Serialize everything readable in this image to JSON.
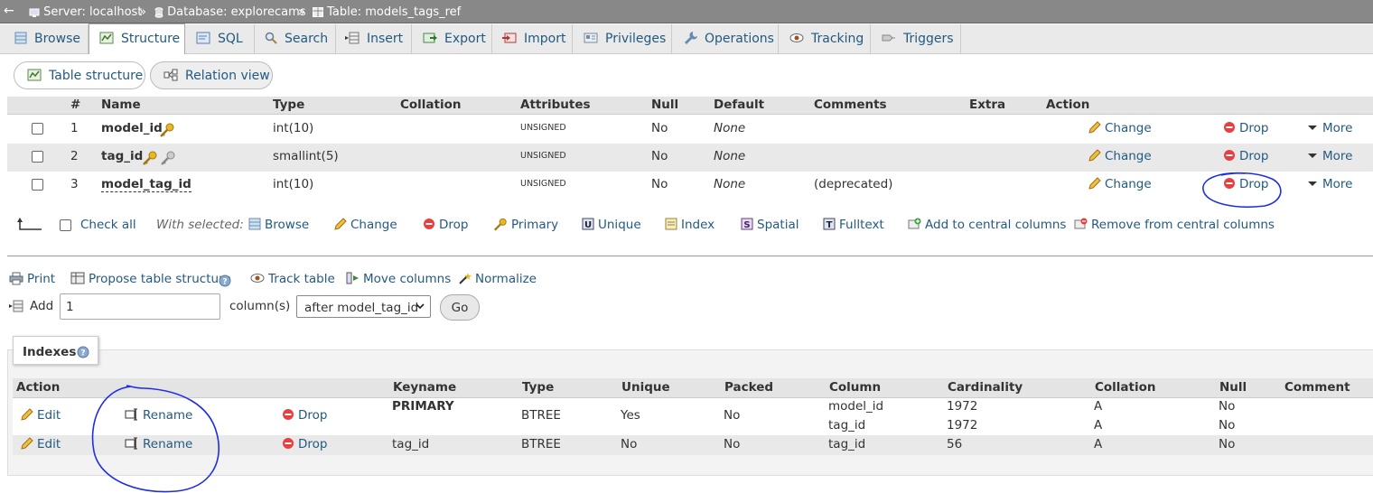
{
  "breadcrumb": {
    "back": "←",
    "server": "Server: localhost",
    "database": "Database: explorecams",
    "table": "Table: models_tags_ref",
    "sep": "»"
  },
  "tabs": [
    {
      "label": "Browse",
      "icon": "browse-icon"
    },
    {
      "label": "Structure",
      "icon": "structure-icon"
    },
    {
      "label": "SQL",
      "icon": "sql-icon"
    },
    {
      "label": "Search",
      "icon": "search-icon"
    },
    {
      "label": "Insert",
      "icon": "insert-icon"
    },
    {
      "label": "Export",
      "icon": "export-icon"
    },
    {
      "label": "Import",
      "icon": "import-icon"
    },
    {
      "label": "Privileges",
      "icon": "privileges-icon"
    },
    {
      "label": "Operations",
      "icon": "wrench-icon"
    },
    {
      "label": "Tracking",
      "icon": "eye-icon"
    },
    {
      "label": "Triggers",
      "icon": "triggers-icon"
    }
  ],
  "subtabs": {
    "table_structure": "Table structure",
    "relation_view": "Relation view"
  },
  "structure": {
    "headers": {
      "num": "#",
      "name": "Name",
      "type": "Type",
      "collation": "Collation",
      "attributes": "Attributes",
      "null": "Null",
      "default": "Default",
      "comments": "Comments",
      "extra": "Extra",
      "action": "Action"
    },
    "rows": [
      {
        "num": "1",
        "name": "model_id",
        "type": "int(10)",
        "attributes": "UNSIGNED",
        "null": "No",
        "default": "None",
        "comments": ""
      },
      {
        "num": "2",
        "name": "tag_id",
        "type": "smallint(5)",
        "attributes": "UNSIGNED",
        "null": "No",
        "default": "None",
        "comments": ""
      },
      {
        "num": "3",
        "name": "model_tag_id",
        "type": "int(10)",
        "attributes": "UNSIGNED",
        "null": "No",
        "default": "None",
        "comments": "(deprecated)"
      }
    ],
    "actions": {
      "change": "Change",
      "drop": "Drop",
      "more": "More"
    }
  },
  "bulk": {
    "check_all": "Check all",
    "with_selected": "With selected:",
    "browse": "Browse",
    "change": "Change",
    "drop": "Drop",
    "primary": "Primary",
    "unique": "Unique",
    "index": "Index",
    "spatial": "Spatial",
    "fulltext": "Fulltext",
    "add_central": "Add to central columns",
    "remove_central": "Remove from central columns"
  },
  "tools": {
    "print": "Print",
    "propose": "Propose table structure",
    "track": "Track table",
    "move": "Move columns",
    "normalize": "Normalize"
  },
  "add_column": {
    "label": "Add",
    "value": "1",
    "suffix": "column(s)",
    "position": "after model_tag_id",
    "go": "Go"
  },
  "indexes": {
    "title": "Indexes",
    "headers": {
      "action": "Action",
      "keyname": "Keyname",
      "type": "Type",
      "unique": "Unique",
      "packed": "Packed",
      "column": "Column",
      "cardinality": "Cardinality",
      "collation": "Collation",
      "null": "Null",
      "comment": "Comment"
    },
    "actions": {
      "edit": "Edit",
      "rename": "Rename",
      "drop": "Drop"
    },
    "rows": [
      {
        "keyname": "PRIMARY",
        "type": "BTREE",
        "unique": "Yes",
        "packed": "No",
        "columns": [
          {
            "column": "model_id",
            "cardinality": "1972",
            "collation": "A",
            "null": "No"
          },
          {
            "column": "tag_id",
            "cardinality": "1972",
            "collation": "A",
            "null": "No"
          }
        ]
      },
      {
        "keyname": "tag_id",
        "type": "BTREE",
        "unique": "No",
        "packed": "No",
        "columns": [
          {
            "column": "tag_id",
            "cardinality": "56",
            "collation": "A",
            "null": "No"
          }
        ]
      }
    ]
  },
  "colors": {
    "link": "#235a81",
    "annotation": "#1f2ee0",
    "drop_red": "#e02020",
    "key_gold": "#d4a017"
  }
}
